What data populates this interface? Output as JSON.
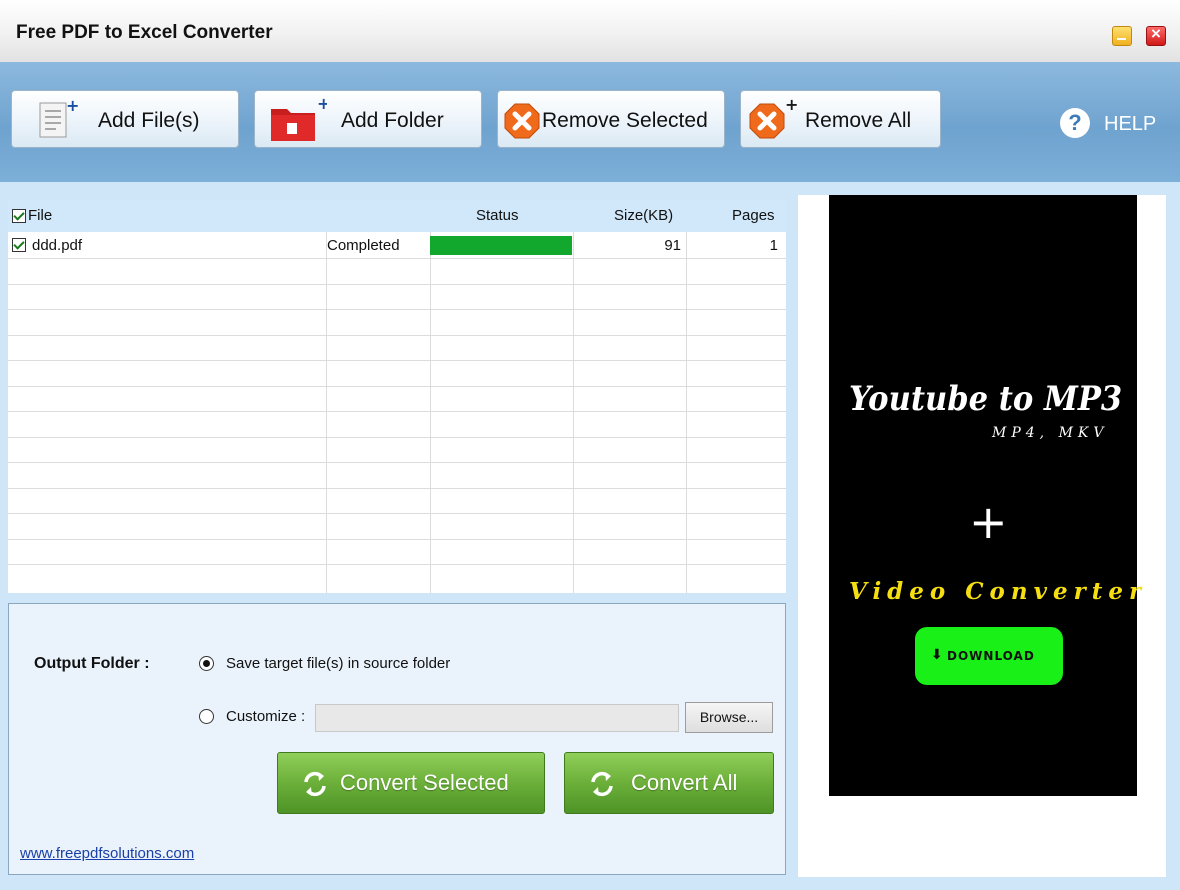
{
  "window": {
    "title": "Free PDF to Excel Converter"
  },
  "toolbar": {
    "add_files": "Add File(s)",
    "add_folder": "Add Folder",
    "remove_selected": "Remove Selected",
    "remove_all": "Remove All",
    "help": "HELP"
  },
  "file_list": {
    "columns": {
      "file": "File",
      "status": "Status",
      "size": "Size(KB)",
      "pages": "Pages"
    },
    "rows": [
      {
        "checked": true,
        "file": "ddd.pdf",
        "status": "Completed",
        "progress": 1.0,
        "size": "91",
        "pages": "1"
      }
    ]
  },
  "output": {
    "label": "Output Folder :",
    "option_source": "Save target file(s) in source folder",
    "option_customize": "Customize :",
    "selected": "source",
    "custom_path": "",
    "browse": "Browse..."
  },
  "actions": {
    "convert_selected": "Convert Selected",
    "convert_all": "Convert All"
  },
  "footer": {
    "website": "www.freepdfsolutions.com"
  },
  "ad": {
    "headline": "Youtube to MP3",
    "subheadline": "MP4, MKV",
    "plus": "+",
    "tagline": "Video Converter",
    "button": "DOWNLOAD"
  },
  "colors": {
    "progress": "#12a82e",
    "ad_accent": "#f5df12",
    "ad_button": "#18f018"
  }
}
